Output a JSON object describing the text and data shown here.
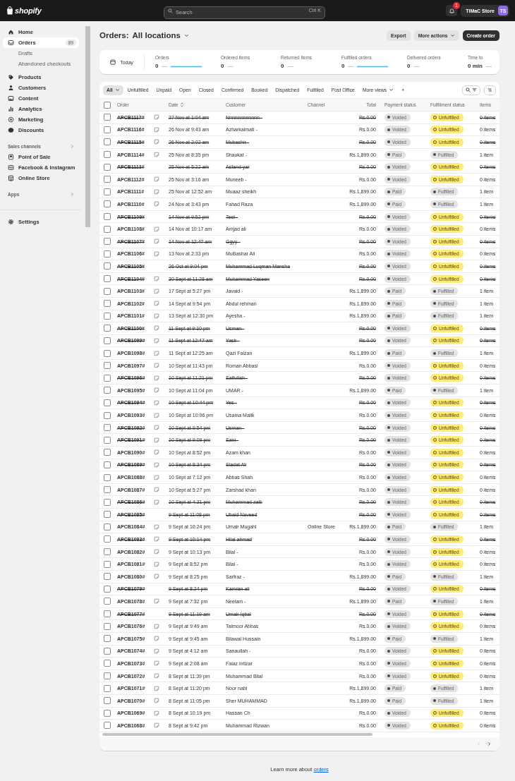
{
  "topbar": {
    "logo": "shopify",
    "search": {
      "placeholder": "Search",
      "shortcut": "Ctrl K"
    },
    "notifications": "1",
    "store": "TIMaC Store",
    "avatar": "TS"
  },
  "sidebar": {
    "items": [
      {
        "label": "Home",
        "selected": false
      },
      {
        "label": "Orders",
        "selected": true,
        "badge": "89",
        "children": [
          {
            "label": "Drafts",
            "selected": false
          },
          {
            "label": "Abandoned checkouts",
            "selected": false
          }
        ]
      },
      {
        "label": "Products",
        "selected": false
      },
      {
        "label": "Customers",
        "selected": false
      },
      {
        "label": "Content",
        "selected": false
      },
      {
        "label": "Analytics",
        "selected": false
      },
      {
        "label": "Marketing",
        "selected": false
      },
      {
        "label": "Discounts",
        "selected": false
      }
    ],
    "sections": [
      {
        "title": "Sales channels",
        "items": [
          {
            "label": "Point of Sale",
            "selected": false
          },
          {
            "label": "Facebook & Instagram",
            "selected": false
          },
          {
            "label": "Online Store",
            "selected": false
          }
        ]
      },
      {
        "title": "Apps"
      }
    ],
    "footer_items": [
      {
        "label": "Settings",
        "selected": false
      }
    ]
  },
  "header": {
    "title": "Orders:",
    "location": "All locations",
    "buttons": [
      {
        "label": "Export",
        "kind": "secondary"
      },
      {
        "label": "More actions",
        "kind": "menu"
      },
      {
        "label": "Create order",
        "kind": "primary"
      }
    ]
  },
  "summary": {
    "period": "Today",
    "metrics": [
      {
        "label": "Orders",
        "value": "0",
        "change": "—",
        "sparkline": true
      },
      {
        "label": "Ordered items",
        "value": "0",
        "change": "—",
        "sparkline": false
      },
      {
        "label": "Returned items",
        "value": "0",
        "change": "—",
        "sparkline": false
      },
      {
        "label": "Fulfilled orders",
        "value": "0",
        "change": "—",
        "sparkline": true
      },
      {
        "label": "Delivered orders",
        "value": "0",
        "change": "—",
        "sparkline": false
      },
      {
        "label": "Time to",
        "value": "0 min",
        "change": "—",
        "sparkline": false
      }
    ]
  },
  "tabs": [
    {
      "label": "All",
      "selected": true
    },
    {
      "label": "Unfulfilled",
      "selected": false
    },
    {
      "label": "Unpaid",
      "selected": false
    },
    {
      "label": "Open",
      "selected": false
    },
    {
      "label": "Closed",
      "selected": false
    },
    {
      "label": "Confirmed",
      "selected": false
    },
    {
      "label": "Booked",
      "selected": false
    },
    {
      "label": "Dispatched",
      "selected": false
    },
    {
      "label": "Fulfilled",
      "selected": false
    },
    {
      "label": "Post Office",
      "selected": false
    },
    {
      "label": "More views",
      "selected": false
    },
    {
      "label": "+",
      "selected": false
    }
  ],
  "table": {
    "columns": [
      "Order",
      "Date",
      "Customer",
      "Channel",
      "Total",
      "Payment status",
      "Fulfillment status",
      "Items"
    ],
    "select_all": {
      "checked": false
    },
    "rows": [
      {
        "checked": false,
        "order": "APCB1117#",
        "note": true,
        "date": "27 Nov at 1:04 am",
        "customer": "Nnnnnnnnnnnn -",
        "total": "Rs.0.00",
        "payment": "Voided",
        "fulfillment": "Unfulfilled",
        "fulfilled": false,
        "items": "0 items",
        "cancelled": true
      },
      {
        "checked": false,
        "order": "APCB1116#",
        "note": true,
        "date": "26 Nov at 9:43 am",
        "customer": "Azharkalmati -",
        "total": "Rs.0.00",
        "payment": "Voided",
        "fulfillment": "Unfulfilled",
        "fulfilled": false,
        "items": "0 items",
        "cancelled": false
      },
      {
        "checked": false,
        "order": "APCB1115#",
        "note": true,
        "date": "26 Nov at 2:02 am",
        "customer": "Mubashir -",
        "total": "Rs.0.00",
        "payment": "Voided",
        "fulfillment": "Unfulfilled",
        "fulfilled": false,
        "items": "0 items",
        "cancelled": true
      },
      {
        "checked": false,
        "order": "APCB1114#",
        "note": true,
        "date": "25 Nov at 8:35 pm",
        "customer": "Shaukat -",
        "total": "Rs.1,899.00",
        "payment": "Paid",
        "fulfillment": "Fulfilled",
        "fulfilled": true,
        "items": "1 item",
        "cancelled": false
      },
      {
        "checked": false,
        "order": "APCB1113#",
        "note": false,
        "date": "25 Nov at 5:22 am",
        "customer": "Asfand yar",
        "total": "Rs.0.00",
        "payment": "Voided",
        "fulfillment": "Unfulfilled",
        "fulfilled": false,
        "items": "0 items",
        "cancelled": true
      },
      {
        "checked": false,
        "order": "APCB1112#",
        "note": true,
        "date": "25 Nov at 3:16 am",
        "customer": "Muneeb -",
        "total": "Rs.0.00",
        "payment": "Voided",
        "fulfillment": "Unfulfilled",
        "fulfilled": false,
        "items": "0 items",
        "cancelled": false
      },
      {
        "checked": false,
        "order": "APCB1111#",
        "note": true,
        "date": "25 Nov at 12:52 am",
        "customer": "Muaaz sheikh",
        "total": "Rs.1,899.00",
        "payment": "Paid",
        "fulfillment": "Fulfilled",
        "fulfilled": true,
        "items": "1 item",
        "cancelled": false
      },
      {
        "checked": false,
        "order": "APCB1110#",
        "note": true,
        "date": "24 Nov at 3:43 pm",
        "customer": "Fahad Raza",
        "total": "Rs.1,899.00",
        "payment": "Paid",
        "fulfillment": "Fulfilled",
        "fulfilled": true,
        "items": "1 item",
        "cancelled": false
      },
      {
        "checked": false,
        "order": "APCB1109#",
        "note": false,
        "date": "14 Nov at 9:52 pm",
        "customer": "Test -",
        "total": "Rs.0.00",
        "payment": "Voided",
        "fulfillment": "Unfulfilled",
        "fulfilled": false,
        "items": "0 items",
        "cancelled": true
      },
      {
        "checked": false,
        "order": "APCB1108#",
        "note": true,
        "date": "14 Nov at 10:17 am",
        "customer": "Amjad ali",
        "total": "Rs.0.00",
        "payment": "Voided",
        "fulfillment": "Unfulfilled",
        "fulfilled": false,
        "items": "0 items",
        "cancelled": false
      },
      {
        "checked": false,
        "order": "APCB1107#",
        "note": true,
        "date": "14 Nov at 12:47 am",
        "customer": "Ggyy -",
        "total": "Rs.0.00",
        "payment": "Voided",
        "fulfillment": "Unfulfilled",
        "fulfilled": false,
        "items": "0 items",
        "cancelled": true
      },
      {
        "checked": false,
        "order": "APCB1106#",
        "note": true,
        "date": "13 Nov at 2:33 pm",
        "customer": "MuBashar Ali",
        "total": "Rs.0.00",
        "payment": "Voided",
        "fulfillment": "Unfulfilled",
        "fulfilled": false,
        "items": "0 items",
        "cancelled": false
      },
      {
        "checked": false,
        "order": "APCB1105#",
        "note": false,
        "date": "26 Oct at 9:04 pm",
        "customer": "Muhammad Luqman Mansha",
        "total": "Rs.0.00",
        "payment": "Voided",
        "fulfillment": "Unfulfilled",
        "fulfilled": false,
        "items": "0 items",
        "cancelled": true
      },
      {
        "checked": false,
        "order": "APCB1104#",
        "note": true,
        "date": "30 Sept at 11:28 am",
        "customer": "Muhammad Yaseen",
        "total": "Rs.0.00",
        "payment": "Voided",
        "fulfillment": "Unfulfilled",
        "fulfilled": false,
        "items": "0 items",
        "cancelled": true
      },
      {
        "checked": false,
        "order": "APCB1103#",
        "note": true,
        "date": "17 Sept at 5:27 pm",
        "customer": "Javaid -",
        "total": "Rs.1,899.00",
        "payment": "Paid",
        "fulfillment": "Fulfilled",
        "fulfilled": true,
        "items": "1 item",
        "cancelled": false
      },
      {
        "checked": false,
        "order": "APCB1102#",
        "note": true,
        "date": "14 Sept at 9:54 pm",
        "customer": "Abdul rehman",
        "total": "Rs.1,899.00",
        "payment": "Paid",
        "fulfillment": "Fulfilled",
        "fulfilled": true,
        "items": "1 item",
        "cancelled": false
      },
      {
        "checked": false,
        "order": "APCB1101#",
        "note": true,
        "date": "13 Sept at 12:30 pm",
        "customer": "Ayesha -",
        "total": "Rs.1,899.00",
        "payment": "Paid",
        "fulfillment": "Fulfilled",
        "fulfilled": true,
        "items": "1 item",
        "cancelled": false
      },
      {
        "checked": false,
        "order": "APCB1100#",
        "note": true,
        "date": "11 Sept at 9:10 pm",
        "customer": "Usman -",
        "total": "Rs.0.00",
        "payment": "Voided",
        "fulfillment": "Unfulfilled",
        "fulfilled": false,
        "items": "0 items",
        "cancelled": true
      },
      {
        "checked": false,
        "order": "APCB1099#",
        "note": true,
        "date": "11 Sept at 12:47 am",
        "customer": "Yasir -",
        "total": "Rs.0.00",
        "payment": "Voided",
        "fulfillment": "Unfulfilled",
        "fulfilled": false,
        "items": "0 items",
        "cancelled": true
      },
      {
        "checked": false,
        "order": "APCB1098#",
        "note": true,
        "date": "11 Sept at 12:25 am",
        "customer": "Qazi Faizan",
        "total": "Rs.1,899.00",
        "payment": "Paid",
        "fulfillment": "Fulfilled",
        "fulfilled": true,
        "items": "1 item",
        "cancelled": false
      },
      {
        "checked": false,
        "order": "APCB1097#",
        "note": true,
        "date": "10 Sept at 11:43 pm",
        "customer": "Roman Abbasi",
        "total": "Rs.0.00",
        "payment": "Voided",
        "fulfillment": "Unfulfilled",
        "fulfilled": false,
        "items": "0 items",
        "cancelled": false
      },
      {
        "checked": false,
        "order": "APCB1096#",
        "note": true,
        "date": "10 Sept at 11:21 pm",
        "customer": "Saifullah -",
        "total": "Rs.0.00",
        "payment": "Voided",
        "fulfillment": "Unfulfilled",
        "fulfilled": false,
        "items": "0 items",
        "cancelled": true
      },
      {
        "checked": false,
        "order": "APCB1095#",
        "note": true,
        "date": "10 Sept at 11:04 pm",
        "customer": "UMAR -",
        "total": "Rs.1,899.00",
        "payment": "Paid",
        "fulfillment": "Fulfilled",
        "fulfilled": true,
        "items": "1 item",
        "cancelled": false
      },
      {
        "checked": false,
        "order": "APCB1094#",
        "note": true,
        "date": "10 Sept at 10:44 pm",
        "customer": "Yes -",
        "total": "Rs.0.00",
        "payment": "Voided",
        "fulfillment": "Unfulfilled",
        "fulfilled": false,
        "items": "0 items",
        "cancelled": true
      },
      {
        "checked": false,
        "order": "APCB1093#",
        "note": true,
        "date": "10 Sept at 10:06 pm",
        "customer": "Usama Malik",
        "total": "Rs.0.00",
        "payment": "Voided",
        "fulfillment": "Unfulfilled",
        "fulfilled": false,
        "items": "0 items",
        "cancelled": false
      },
      {
        "checked": false,
        "order": "APCB1092#",
        "note": true,
        "date": "10 Sept at 9:54 pm",
        "customer": "Usman -",
        "total": "Rs.0.00",
        "payment": "Voided",
        "fulfillment": "Unfulfilled",
        "fulfilled": false,
        "items": "0 items",
        "cancelled": true
      },
      {
        "checked": false,
        "order": "APCB1091#",
        "note": true,
        "date": "10 Sept at 9:09 pm",
        "customer": "Sani -",
        "total": "Rs.0.00",
        "payment": "Voided",
        "fulfillment": "Unfulfilled",
        "fulfilled": false,
        "items": "0 items",
        "cancelled": true
      },
      {
        "checked": false,
        "order": "APCB1090#",
        "note": true,
        "date": "10 Sept at 8:52 pm",
        "customer": "Azam khan",
        "total": "Rs.0.00",
        "payment": "Voided",
        "fulfillment": "Unfulfilled",
        "fulfilled": false,
        "items": "0 items",
        "cancelled": false
      },
      {
        "checked": false,
        "order": "APCB1089#",
        "note": true,
        "date": "10 Sept at 8:34 pm",
        "customer": "Siadat Ali",
        "total": "Rs.0.00",
        "payment": "Voided",
        "fulfillment": "Unfulfilled",
        "fulfilled": false,
        "items": "0 items",
        "cancelled": true
      },
      {
        "checked": false,
        "order": "APCB1088#",
        "note": true,
        "date": "10 Sept at 7:12 pm",
        "customer": "Abbas Shah",
        "total": "Rs.0.00",
        "payment": "Voided",
        "fulfillment": "Unfulfilled",
        "fulfilled": false,
        "items": "0 items",
        "cancelled": false
      },
      {
        "checked": false,
        "order": "APCB1087#",
        "note": true,
        "date": "10 Sept at 5:27 pm",
        "customer": "Zarshad khan",
        "total": "Rs.0.00",
        "payment": "Voided",
        "fulfillment": "Unfulfilled",
        "fulfilled": false,
        "items": "0 items",
        "cancelled": false
      },
      {
        "checked": false,
        "order": "APCB1086#",
        "note": true,
        "date": "10 Sept at 4:31 pm",
        "customer": "Muhammad zaib",
        "total": "Rs.0.00",
        "payment": "Voided",
        "fulfillment": "Unfulfilled",
        "fulfilled": false,
        "items": "0 items",
        "cancelled": true
      },
      {
        "checked": false,
        "order": "APCB1085#",
        "note": false,
        "date": "9 Sept at 11:08 pm",
        "customer": "Ubaid Naveed",
        "total": "Rs.0.00",
        "payment": "Voided",
        "fulfillment": "Unfulfilled",
        "fulfilled": false,
        "items": "0 items",
        "cancelled": true
      },
      {
        "checked": false,
        "order": "APCB1084#",
        "note": true,
        "date": "9 Sept at 10:24 pm",
        "customer": "Umair Mugahl",
        "channel": "Online Store",
        "total": "Rs.1,899.00",
        "payment": "Paid",
        "fulfillment": "Fulfilled",
        "fulfilled": true,
        "items": "1 item",
        "cancelled": false
      },
      {
        "checked": false,
        "order": "APCB1083#",
        "note": true,
        "date": "9 Sept at 10:14 pm",
        "customer": "Hilal ahmad",
        "total": "Rs.0.00",
        "payment": "Voided",
        "fulfillment": "Unfulfilled",
        "fulfilled": false,
        "items": "0 items",
        "cancelled": true
      },
      {
        "checked": false,
        "order": "APCB1082#",
        "note": true,
        "date": "9 Sept at 10:13 pm",
        "customer": "Bilal -",
        "total": "Rs.0.00",
        "payment": "Voided",
        "fulfillment": "Unfulfilled",
        "fulfilled": false,
        "items": "0 items",
        "cancelled": false
      },
      {
        "checked": false,
        "order": "APCB1081#",
        "note": true,
        "date": "9 Sept at 8:52 pm",
        "customer": "Bilal -",
        "total": "Rs.0.00",
        "payment": "Voided",
        "fulfillment": "Unfulfilled",
        "fulfilled": false,
        "items": "0 items",
        "cancelled": false
      },
      {
        "checked": false,
        "order": "APCB1080#",
        "note": true,
        "date": "9 Sept at 8:25 pm",
        "customer": "Sarfraz -",
        "total": "Rs.1,899.00",
        "payment": "Paid",
        "fulfillment": "Fulfilled",
        "fulfilled": true,
        "items": "1 item",
        "cancelled": false
      },
      {
        "checked": false,
        "order": "APCB1079#",
        "note": false,
        "date": "9 Sept at 8:24 pm",
        "customer": "Kamran ali",
        "total": "Rs.0.00",
        "payment": "Voided",
        "fulfillment": "Unfulfilled",
        "fulfilled": false,
        "items": "0 items",
        "cancelled": true
      },
      {
        "checked": false,
        "order": "APCB1078#",
        "note": true,
        "date": "9 Sept at 7:32 pm",
        "customer": "Neelam -",
        "total": "Rs.1,899.00",
        "payment": "Paid",
        "fulfillment": "Fulfilled",
        "fulfilled": true,
        "items": "1 item",
        "cancelled": false
      },
      {
        "checked": false,
        "order": "APCB1077#",
        "note": false,
        "date": "9 Sept at 11:19 am",
        "customer": "Umair Iqbal",
        "total": "Rs.0.00",
        "payment": "Voided",
        "fulfillment": "Unfulfilled",
        "fulfilled": false,
        "items": "0 items",
        "cancelled": true
      },
      {
        "checked": false,
        "order": "APCB1076#",
        "note": true,
        "date": "9 Sept at 9:49 am",
        "customer": "Taimoor Abbas",
        "total": "Rs.0.00",
        "payment": "Voided",
        "fulfillment": "Unfulfilled",
        "fulfilled": false,
        "items": "0 items",
        "cancelled": false
      },
      {
        "checked": false,
        "order": "APCB1075#",
        "note": true,
        "date": "9 Sept at 9:45 am",
        "customer": "Bilawal Hussain",
        "total": "Rs.1,899.00",
        "payment": "Paid",
        "fulfillment": "Fulfilled",
        "fulfilled": true,
        "items": "1 item",
        "cancelled": false
      },
      {
        "checked": false,
        "order": "APCB1074#",
        "note": true,
        "date": "9 Sept at 4:12 am",
        "customer": "Sanaullah -",
        "total": "Rs.0.00",
        "payment": "Voided",
        "fulfillment": "Unfulfilled",
        "fulfilled": false,
        "items": "0 items",
        "cancelled": false
      },
      {
        "checked": false,
        "order": "APCB1073#",
        "note": true,
        "date": "9 Sept at 2:08 am",
        "customer": "Faiaz intizar",
        "total": "Rs.0.00",
        "payment": "Voided",
        "fulfillment": "Unfulfilled",
        "fulfilled": false,
        "items": "0 items",
        "cancelled": false
      },
      {
        "checked": false,
        "order": "APCB1072#",
        "note": true,
        "date": "8 Sept at 11:39 pm",
        "customer": "Muhammad Bilal",
        "total": "Rs.0.00",
        "payment": "Voided",
        "fulfillment": "Unfulfilled",
        "fulfilled": false,
        "items": "0 items",
        "cancelled": false
      },
      {
        "checked": false,
        "order": "APCB1071#",
        "note": true,
        "date": "8 Sept at 11:20 pm",
        "customer": "Noor nabi",
        "total": "Rs.1,899.00",
        "payment": "Paid",
        "fulfillment": "Fulfilled",
        "fulfilled": true,
        "items": "1 item",
        "cancelled": false
      },
      {
        "checked": false,
        "order": "APCB1070#",
        "note": true,
        "date": "8 Sept at 11:05 pm",
        "customer": "Sher MUHAMMAD",
        "total": "Rs.1,899.00",
        "payment": "Paid",
        "fulfillment": "Fulfilled",
        "fulfilled": true,
        "items": "1 item",
        "cancelled": false
      },
      {
        "checked": false,
        "order": "APCB1069#",
        "note": true,
        "date": "8 Sept at 10:19 pm",
        "customer": "Hassan Ch",
        "total": "Rs.0.00",
        "payment": "Voided",
        "fulfillment": "Unfulfilled",
        "fulfilled": false,
        "items": "0 items",
        "cancelled": false
      },
      {
        "checked": false,
        "order": "APCB1068#",
        "note": true,
        "date": "8 Sept at 9:42 pm",
        "customer": "Muhammad Rizwan",
        "total": "Rs.0.00",
        "payment": "Voided",
        "fulfillment": "Unfulfilled",
        "fulfilled": false,
        "items": "0 items",
        "cancelled": false
      }
    ]
  },
  "footer": {
    "text": "Learn more about",
    "link": "orders"
  }
}
